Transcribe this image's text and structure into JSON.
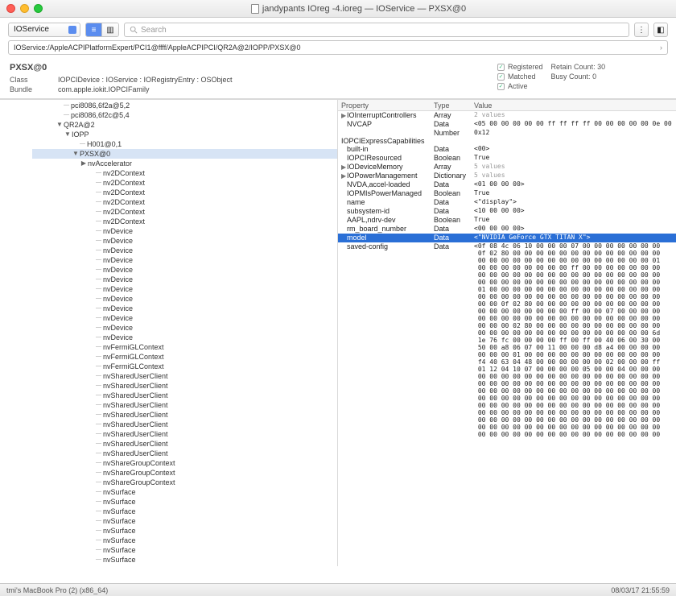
{
  "window": {
    "title": "jandypants IOreg -4.ioreg — IOService — PXSX@0"
  },
  "toolbar": {
    "selector": "IOService",
    "search_placeholder": "Search"
  },
  "pathbar": "IOService:/AppleACPIPlatformExpert/PCI1@ffff/AppleACPIPCI/QR2A@2/IOPP/PXSX@0",
  "header": {
    "title": "PXSX@0",
    "class_label": "Class",
    "class_value": "IOPCIDevice : IOService : IORegistryEntry : OSObject",
    "bundle_label": "Bundle",
    "bundle_value": "com.apple.iokit.IOPCIFamily",
    "registered": "Registered",
    "matched": "Matched",
    "active": "Active",
    "retain_label": "Retain Count:",
    "retain_value": "30",
    "busy_label": "Busy Count:",
    "busy_value": "0"
  },
  "tree": [
    {
      "i": 2,
      "d": "",
      "t": "pci8086,6f2a@5,2"
    },
    {
      "i": 2,
      "d": "",
      "t": "pci8086,6f2c@5,4"
    },
    {
      "i": 2,
      "d": "▼",
      "t": "QR2A@2"
    },
    {
      "i": 3,
      "d": "▼",
      "t": "IOPP"
    },
    {
      "i": 4,
      "d": "",
      "t": "H001@0,1"
    },
    {
      "i": 4,
      "d": "▼",
      "t": "PXSX@0",
      "sel": true
    },
    {
      "i": 5,
      "d": "▶",
      "t": "nvAccelerator"
    },
    {
      "i": 6,
      "d": "",
      "t": "nv2DContext"
    },
    {
      "i": 6,
      "d": "",
      "t": "nv2DContext"
    },
    {
      "i": 6,
      "d": "",
      "t": "nv2DContext"
    },
    {
      "i": 6,
      "d": "",
      "t": "nv2DContext"
    },
    {
      "i": 6,
      "d": "",
      "t": "nv2DContext"
    },
    {
      "i": 6,
      "d": "",
      "t": "nv2DContext"
    },
    {
      "i": 6,
      "d": "",
      "t": "nvDevice"
    },
    {
      "i": 6,
      "d": "",
      "t": "nvDevice"
    },
    {
      "i": 6,
      "d": "",
      "t": "nvDevice"
    },
    {
      "i": 6,
      "d": "",
      "t": "nvDevice"
    },
    {
      "i": 6,
      "d": "",
      "t": "nvDevice"
    },
    {
      "i": 6,
      "d": "",
      "t": "nvDevice"
    },
    {
      "i": 6,
      "d": "",
      "t": "nvDevice"
    },
    {
      "i": 6,
      "d": "",
      "t": "nvDevice"
    },
    {
      "i": 6,
      "d": "",
      "t": "nvDevice"
    },
    {
      "i": 6,
      "d": "",
      "t": "nvDevice"
    },
    {
      "i": 6,
      "d": "",
      "t": "nvDevice"
    },
    {
      "i": 6,
      "d": "",
      "t": "nvDevice"
    },
    {
      "i": 6,
      "d": "",
      "t": "nvFermiGLContext"
    },
    {
      "i": 6,
      "d": "",
      "t": "nvFermiGLContext"
    },
    {
      "i": 6,
      "d": "",
      "t": "nvFermiGLContext"
    },
    {
      "i": 6,
      "d": "",
      "t": "nvSharedUserClient"
    },
    {
      "i": 6,
      "d": "",
      "t": "nvSharedUserClient"
    },
    {
      "i": 6,
      "d": "",
      "t": "nvSharedUserClient"
    },
    {
      "i": 6,
      "d": "",
      "t": "nvSharedUserClient"
    },
    {
      "i": 6,
      "d": "",
      "t": "nvSharedUserClient"
    },
    {
      "i": 6,
      "d": "",
      "t": "nvSharedUserClient"
    },
    {
      "i": 6,
      "d": "",
      "t": "nvSharedUserClient"
    },
    {
      "i": 6,
      "d": "",
      "t": "nvSharedUserClient"
    },
    {
      "i": 6,
      "d": "",
      "t": "nvSharedUserClient"
    },
    {
      "i": 6,
      "d": "",
      "t": "nvShareGroupContext"
    },
    {
      "i": 6,
      "d": "",
      "t": "nvShareGroupContext"
    },
    {
      "i": 6,
      "d": "",
      "t": "nvShareGroupContext"
    },
    {
      "i": 6,
      "d": "",
      "t": "nvSurface"
    },
    {
      "i": 6,
      "d": "",
      "t": "nvSurface"
    },
    {
      "i": 6,
      "d": "",
      "t": "nvSurface"
    },
    {
      "i": 6,
      "d": "",
      "t": "nvSurface"
    },
    {
      "i": 6,
      "d": "",
      "t": "nvSurface"
    },
    {
      "i": 6,
      "d": "",
      "t": "nvSurface"
    },
    {
      "i": 6,
      "d": "",
      "t": "nvSurface"
    },
    {
      "i": 6,
      "d": "",
      "t": "nvSurface"
    },
    {
      "i": 6,
      "d": "",
      "t": "nvSurface"
    }
  ],
  "props": {
    "cols": {
      "p": "Property",
      "t": "Type",
      "v": "Value"
    },
    "rows": [
      {
        "tri": "▶",
        "p": "IOInterruptControllers",
        "t": "Array",
        "v": "2 values",
        "g": true
      },
      {
        "p": "NVCAP",
        "t": "Data",
        "v": "<05 00 00 00 00 00 ff ff ff ff 00 00 00 00 00 0e 00 00 00 00>"
      },
      {
        "p": "IOPCIExpressCapabilities",
        "t": "Number",
        "v": "0x12"
      },
      {
        "p": "built-in",
        "t": "Data",
        "v": "<00>"
      },
      {
        "p": "IOPCIResourced",
        "t": "Boolean",
        "v": "True"
      },
      {
        "tri": "▶",
        "p": "IODeviceMemory",
        "t": "Array",
        "v": "5 values",
        "g": true
      },
      {
        "tri": "▶",
        "p": "IOPowerManagement",
        "t": "Dictionary",
        "v": "5 values",
        "g": true
      },
      {
        "p": "NVDA,accel-loaded",
        "t": "Data",
        "v": "<01 00 00 00>"
      },
      {
        "p": "IOPMIsPowerManaged",
        "t": "Boolean",
        "v": "True"
      },
      {
        "p": "name",
        "t": "Data",
        "v": "<\"display\">"
      },
      {
        "p": "subsystem-id",
        "t": "Data",
        "v": "<10 00 00 00>"
      },
      {
        "p": "AAPL,ndrv-dev",
        "t": "Boolean",
        "v": "True"
      },
      {
        "p": "rm_board_number",
        "t": "Data",
        "v": "<00 00 00 00>"
      },
      {
        "p": "model",
        "t": "Data",
        "v": "<\"NVIDIA GeForce GTX TITAN X\">",
        "sel": true
      },
      {
        "p": "saved-config",
        "t": "Data",
        "v": "<0f 08 4c 06 10 00 00 00 07 00 00 00 00 00 00 00\n 0f 02 80 00 00 00 00 00 00 00 00 00 00 00 00 00\n 00 00 00 00 00 00 00 00 00 00 00 00 00 00 00 01\n 00 00 00 00 00 00 00 00 ff 00 00 00 00 00 00 00\n 00 00 00 00 00 00 00 00 00 00 00 00 00 00 00 00\n 00 00 00 00 00 00 00 00 00 00 00 00 00 00 00 00\n 01 00 00 00 00 00 00 00 00 00 00 00 00 00 00 00\n 00 00 00 00 00 00 00 00 00 00 00 00 00 00 00 00\n 00 00 0f 02 80 00 00 00 00 00 00 00 00 00 00 00\n 00 00 00 00 00 00 00 00 ff 00 00 07 00 00 00 00\n 00 00 00 00 00 00 00 00 00 00 00 00 00 00 00 00\n 00 00 00 02 80 00 00 00 00 00 00 00 00 00 00 00\n 00 00 00 00 00 00 00 00 00 00 00 00 00 00 00 6d\n 1e 76 fc 00 00 00 00 ff 00 ff 00 40 06 00 30 00\n 50 00 a8 06 07 00 11 00 00 00 d8 a4 00 00 00 00\n 00 00 00 01 00 00 00 00 00 00 00 00 00 00 00 00\n f4 40 63 04 48 00 00 00 00 00 00 02 00 00 00 ff\n 01 12 04 10 07 00 00 00 00 05 00 00 04 00 00 00\n 00 00 00 00 00 00 00 00 00 00 00 00 00 00 00 00\n 00 00 00 00 00 00 00 00 00 00 00 00 00 00 00 00\n 00 00 00 00 00 00 00 00 00 00 00 00 00 00 00 00\n 00 00 00 00 00 00 00 00 00 00 00 00 00 00 00 00\n 00 00 00 00 00 00 00 00 00 00 00 00 00 00 00 00\n 00 00 00 00 00 00 00 00 00 00 00 00 00 00 00 00\n 00 00 00 00 00 00 00 00 00 00 00 00 00 00 00 00\n 00 00 00 00 00 00 00 00 00 00 00 00 00 00 00 00\n 00 00 00 00 00 00 00 00 00 00 00 00 00 00 00 00"
      }
    ]
  },
  "statusbar": {
    "left": "tmi's MacBook Pro (2) (x86_64)",
    "right": "08/03/17 21:55:59"
  }
}
